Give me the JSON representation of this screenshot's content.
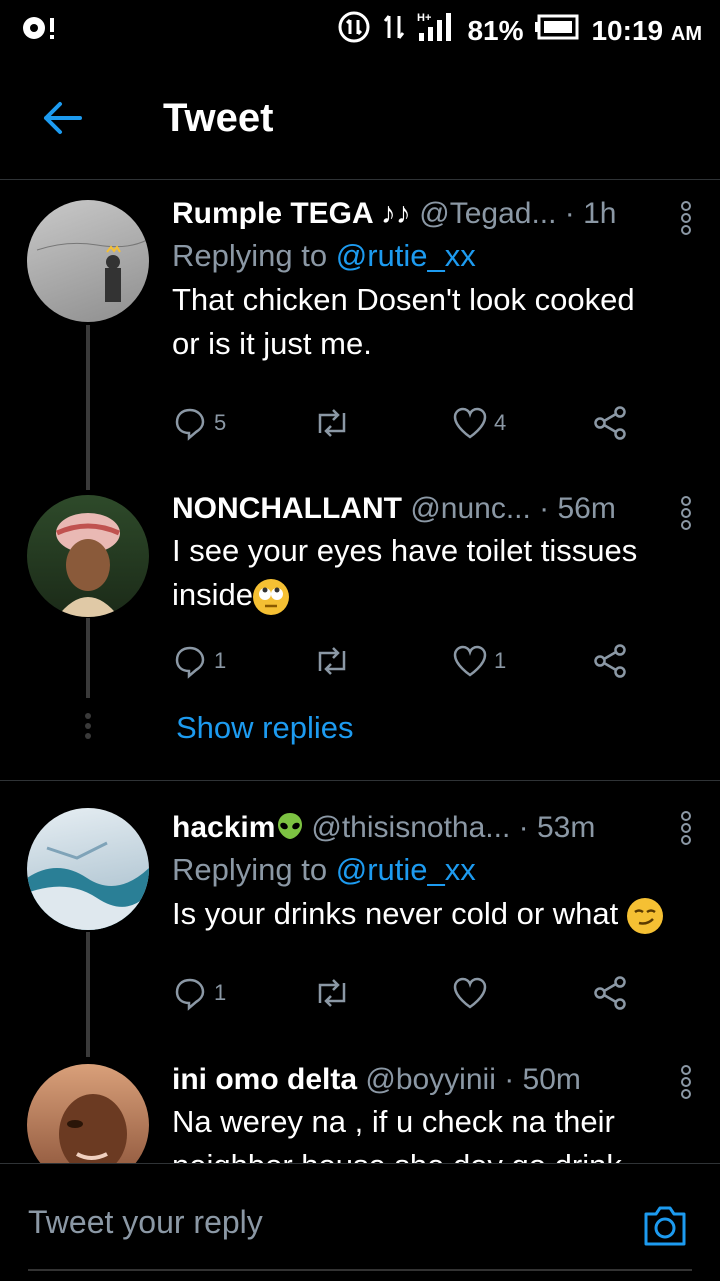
{
  "statusbar": {
    "battery": "81%",
    "time": "10:19",
    "ampm": "AM",
    "network": "H+"
  },
  "header": {
    "title": "Tweet"
  },
  "tweets": [
    {
      "name": "Rumple TEGA ♪♪",
      "handle": "@Tegad...",
      "time": "· 1h",
      "replying_prefix": "Replying to ",
      "replying_handle": "@rutie_xx",
      "text_lines": [
        "That chicken Dosen't look cooked",
        "or is it just me."
      ],
      "replies": "5",
      "retweets": "",
      "likes": "4"
    },
    {
      "name": "NONCHALLANT",
      "handle": "@nunc...",
      "time": "· 56m",
      "text_lines": [
        "I see your eyes have toilet tissues",
        "inside"
      ],
      "replies": "1",
      "retweets": "",
      "likes": "1"
    },
    {
      "name": "hackim",
      "handle": "@thisisnotha...",
      "time": "· 53m",
      "replying_prefix": "Replying to ",
      "replying_handle": "@rutie_xx",
      "text_lines": [
        "Is your drinks never cold or  what"
      ],
      "replies": "1",
      "retweets": "",
      "likes": ""
    },
    {
      "name": "ini omo delta",
      "handle": "@boyyinii",
      "time": "· 50m",
      "text_lines": [
        "Na werey na , if u check na their",
        "neighbor house she dey go drink"
      ]
    }
  ],
  "show_replies": "Show replies",
  "reply_bar": {
    "placeholder": "Tweet your reply"
  },
  "colors": {
    "accent": "#1d9bf0",
    "muted": "#8b98a5",
    "background": "#000000"
  }
}
